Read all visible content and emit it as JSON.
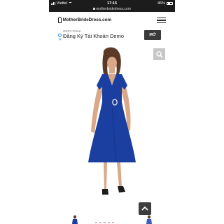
{
  "status_bar": {
    "carrier": "Viettel",
    "time": "17:15",
    "url": "motherbridedress.com",
    "battery_text": "46%",
    "battery_level": 0.46
  },
  "header": {
    "logo_text": "MotherBrideDress.com"
  },
  "ad": {
    "brand": "OKFX Prime",
    "text": "Đăng Ký Tài Khoản Demo",
    "button_label": "MỞ"
  },
  "colors": {
    "dress": "#1a3fa0",
    "status_bar": "#1c1c1c",
    "ad_button": "#3a3a3a",
    "zoom_button": "#c7c7c7",
    "scroll_button": "#3d3d3d"
  }
}
